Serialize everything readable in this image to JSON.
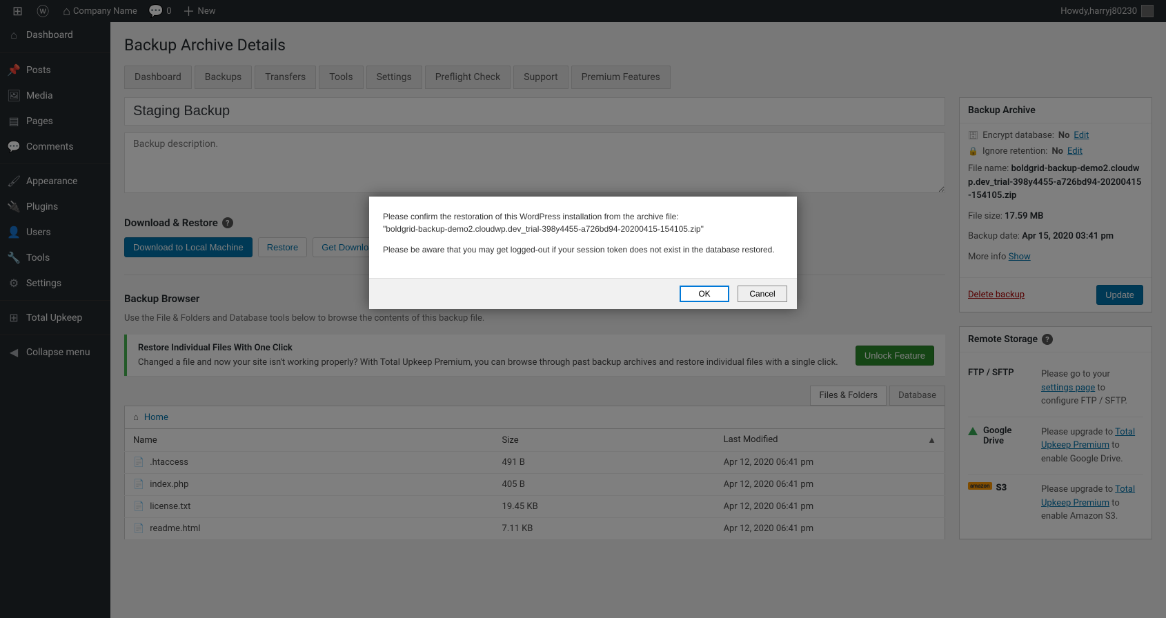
{
  "adminbar": {
    "site_name": "Company Name",
    "comments_count": "0",
    "new_label": "New",
    "howdy_prefix": "Howdy, ",
    "username": "harryj80230"
  },
  "sidebar": {
    "items": [
      {
        "icon": "⌂",
        "label": "Dashboard"
      },
      {
        "icon": "📌",
        "label": "Posts"
      },
      {
        "icon": "🖼",
        "label": "Media"
      },
      {
        "icon": "▤",
        "label": "Pages"
      },
      {
        "icon": "💬",
        "label": "Comments"
      },
      {
        "icon": "🖌",
        "label": "Appearance"
      },
      {
        "icon": "🔌",
        "label": "Plugins"
      },
      {
        "icon": "👤",
        "label": "Users"
      },
      {
        "icon": "🔧",
        "label": "Tools"
      },
      {
        "icon": "⚙",
        "label": "Settings"
      },
      {
        "icon": "⊞",
        "label": "Total Upkeep"
      },
      {
        "icon": "◀",
        "label": "Collapse menu"
      }
    ]
  },
  "page": {
    "title": "Backup Archive Details"
  },
  "tabs": [
    "Dashboard",
    "Backups",
    "Transfers",
    "Tools",
    "Settings",
    "Preflight Check",
    "Support",
    "Premium Features"
  ],
  "backup": {
    "title_value": "Staging Backup",
    "desc_placeholder": "Backup description."
  },
  "download": {
    "heading": "Download & Restore",
    "dl_btn": "Download to Local Machine",
    "restore_btn": "Restore",
    "link_btn": "Get Download Link"
  },
  "browser": {
    "heading": "Backup Browser",
    "sub": "Use the File & Folders and Database tools below to browse the contents of this backup file.",
    "notice_title": "Restore Individual Files With One Click",
    "notice_text": "Changed a file and now your site isn't working properly? With Total Upkeep Premium, you can browse through past backup archives and restore individual files with a single click.",
    "unlock_btn": "Unlock Feature",
    "tab_files": "Files & Folders",
    "tab_db": "Database",
    "home_label": "Home",
    "cols": {
      "name": "Name",
      "size": "Size",
      "modified": "Last Modified"
    },
    "rows": [
      {
        "name": ".htaccess",
        "size": "491 B",
        "modified": "Apr 12, 2020 06:41 pm"
      },
      {
        "name": "index.php",
        "size": "405 B",
        "modified": "Apr 12, 2020 06:41 pm"
      },
      {
        "name": "license.txt",
        "size": "19.45 KB",
        "modified": "Apr 12, 2020 06:41 pm"
      },
      {
        "name": "readme.html",
        "size": "7.11 KB",
        "modified": "Apr 12, 2020 06:41 pm"
      }
    ]
  },
  "archive_panel": {
    "title": "Backup Archive",
    "encrypt_label": "Encrypt database:",
    "encrypt_value": "No",
    "edit": "Edit",
    "retention_label": "Ignore retention:",
    "retention_value": "No",
    "filename_label": "File name:",
    "filename_value": "boldgrid-backup-demo2.cloudwp.dev_trial-398y4455-a726bd94-20200415-154105.zip",
    "filesize_label": "File size:",
    "filesize_value": "17.59 MB",
    "date_label": "Backup date:",
    "date_value": "Apr 15, 2020 03:41 pm",
    "more_label": "More info",
    "show": "Show",
    "delete": "Delete backup",
    "update_btn": "Update"
  },
  "remote_panel": {
    "title": "Remote Storage",
    "ftp": {
      "label": "FTP / SFTP",
      "text_pre": "Please go to your ",
      "link": "settings page",
      "text_post": " to configure FTP / SFTP."
    },
    "gdrive": {
      "label": "Google Drive",
      "text_pre": "Please upgrade to ",
      "link": "Total Upkeep Premium",
      "text_post": " to enable Google Drive."
    },
    "s3": {
      "label": "S3",
      "text_pre": "Please upgrade to ",
      "link": "Total Upkeep Premium",
      "text_post": " to enable Amazon S3."
    }
  },
  "dialog": {
    "line1_pre": "Please confirm the restoration of this WordPress installation from the archive file:",
    "line1_file": "\"boldgrid-backup-demo2.cloudwp.dev_trial-398y4455-a726bd94-20200415-154105.zip\"",
    "line2": "Please be aware that you may get logged-out if your session token does not exist in the database restored.",
    "ok": "OK",
    "cancel": "Cancel"
  }
}
